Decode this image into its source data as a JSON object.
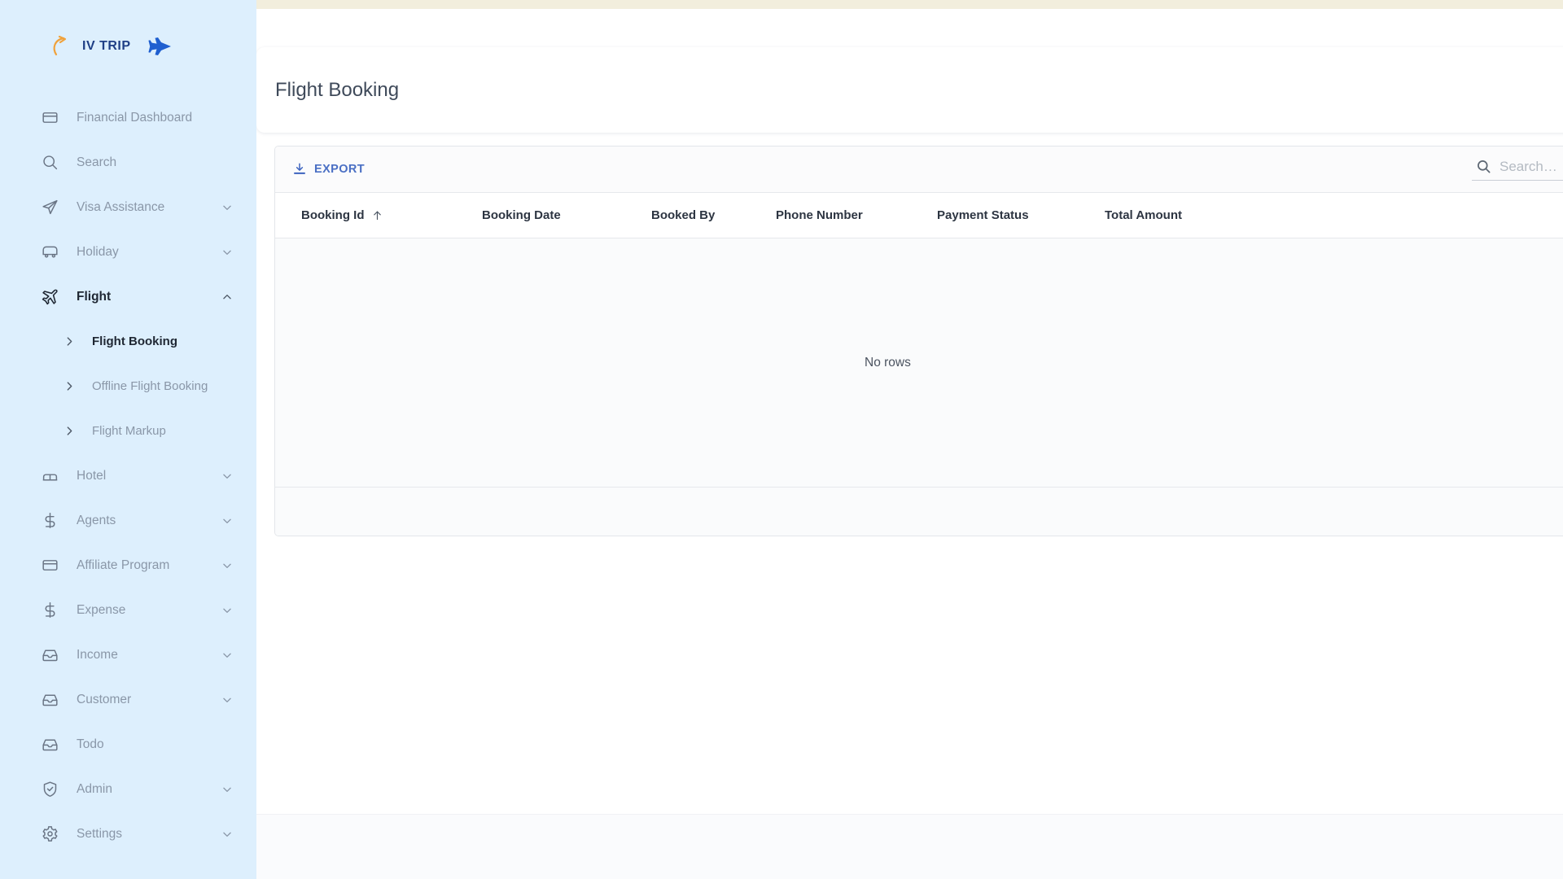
{
  "brand": {
    "name": "IV TRIP",
    "swoosh_icon": "orange-swoosh-arrow-icon",
    "plane_icon": "blue-airplane-icon",
    "text_color": "#1f3f86",
    "accent_color": "#f0a23c"
  },
  "theme": {
    "sidebar_bg": "#ddeffd",
    "top_strip": "#f2eedd",
    "link_blue": "#4a6fc4",
    "content_bg": "#ffffff",
    "grid_body_bg": "#fafbfc"
  },
  "sidebar": {
    "items": [
      {
        "label": "Financial Dashboard",
        "icon": "credit-card-icon",
        "chevron": "",
        "active": false
      },
      {
        "label": "Search",
        "icon": "search-icon",
        "chevron": "",
        "active": false
      },
      {
        "label": "Visa Assistance",
        "icon": "send-icon",
        "chevron": "chevron-down-icon",
        "active": false
      },
      {
        "label": "Holiday",
        "icon": "bus-icon",
        "chevron": "chevron-down-icon",
        "active": false
      },
      {
        "label": "Flight",
        "icon": "airplane-icon",
        "chevron": "chevron-up-icon",
        "active": true
      },
      {
        "label": "Hotel",
        "icon": "bed-icon",
        "chevron": "chevron-down-icon",
        "active": false
      },
      {
        "label": "Agents",
        "icon": "dollar-icon",
        "chevron": "chevron-down-icon",
        "active": false
      },
      {
        "label": "Affiliate Program",
        "icon": "credit-card-icon",
        "chevron": "chevron-down-icon",
        "active": false
      },
      {
        "label": "Expense",
        "icon": "dollar-icon",
        "chevron": "chevron-down-icon",
        "active": false
      },
      {
        "label": "Income",
        "icon": "inbox-icon",
        "chevron": "chevron-down-icon",
        "active": false
      },
      {
        "label": "Customer",
        "icon": "inbox-icon",
        "chevron": "chevron-down-icon",
        "active": false
      },
      {
        "label": "Todo",
        "icon": "inbox-icon",
        "chevron": "",
        "active": false
      },
      {
        "label": "Admin",
        "icon": "shield-check-icon",
        "chevron": "chevron-down-icon",
        "active": false
      },
      {
        "label": "Settings",
        "icon": "gear-icon",
        "chevron": "chevron-down-icon",
        "active": false
      }
    ],
    "flight_submenu": [
      {
        "label": "Flight Booking",
        "icon": "chevron-right-icon",
        "active": true
      },
      {
        "label": "Offline Flight Booking",
        "icon": "chevron-right-icon",
        "active": false
      },
      {
        "label": "Flight Markup",
        "icon": "chevron-right-icon",
        "active": false
      }
    ]
  },
  "header": {
    "title": "Flight Booking"
  },
  "grid": {
    "toolbar": {
      "export_label": "EXPORT",
      "export_icon": "download-icon",
      "search_icon": "search-icon",
      "search_value": "",
      "search_placeholder": "Search…"
    },
    "columns": [
      {
        "label": "Booking Id",
        "sort": "asc",
        "sort_icon": "arrow-up-icon"
      },
      {
        "label": "Booking Date",
        "sort": "",
        "sort_icon": ""
      },
      {
        "label": "Booked By",
        "sort": "",
        "sort_icon": ""
      },
      {
        "label": "Phone Number",
        "sort": "",
        "sort_icon": ""
      },
      {
        "label": "Payment Status",
        "sort": "",
        "sort_icon": ""
      },
      {
        "label": "Total Amount",
        "sort": "",
        "sort_icon": ""
      }
    ],
    "rows": [],
    "empty_message": "No rows"
  }
}
